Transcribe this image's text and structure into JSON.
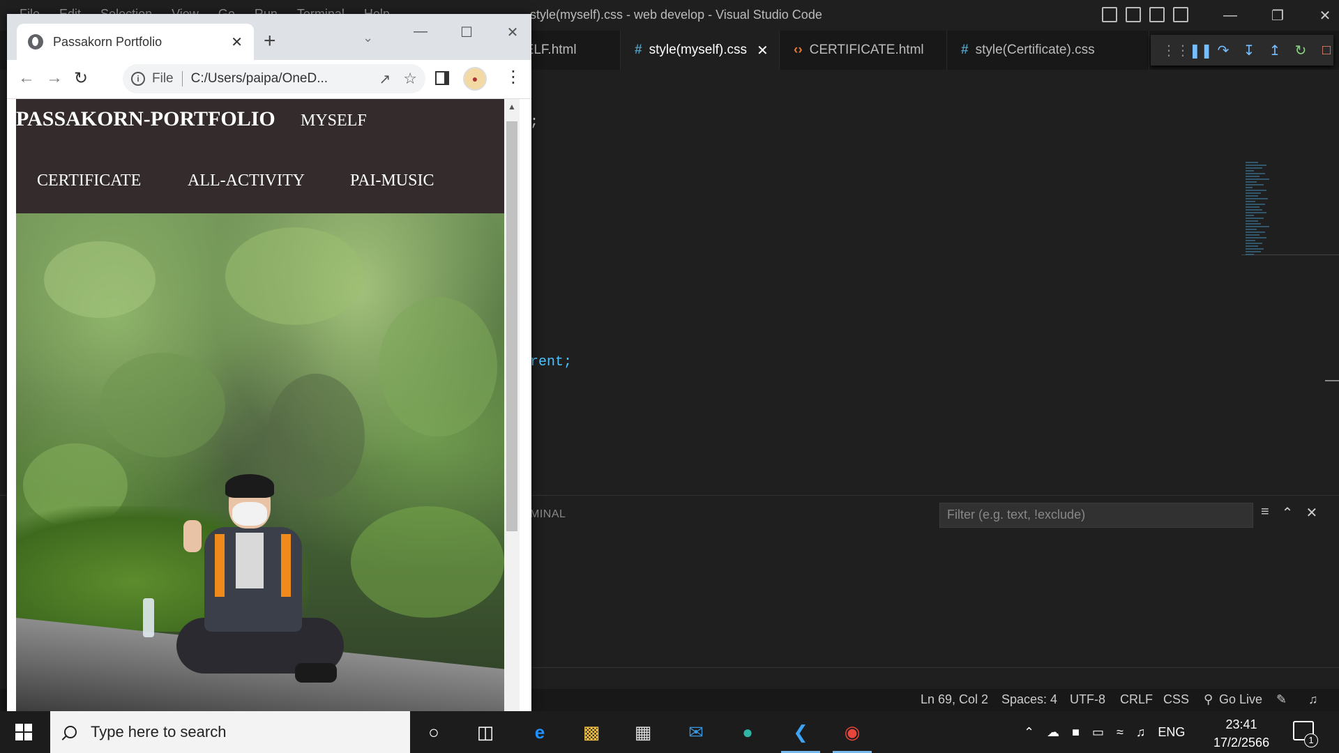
{
  "vscode": {
    "menu": [
      "File",
      "Edit",
      "Selection",
      "View",
      "Go",
      "Run",
      "Terminal",
      "Help"
    ],
    "title": "style(myself).css - web develop - Visual Studio Code",
    "tabs": [
      {
        "label": "MYSELF.html",
        "icon": "html",
        "visible_label": "SELF.html"
      },
      {
        "label": "style(myself).css",
        "icon": "css",
        "active": true
      },
      {
        "label": "CERTIFICATE.html",
        "icon": "html"
      },
      {
        "label": "style(Certificate).css",
        "icon": "css"
      }
    ],
    "debug_toolbar": [
      "grip-icon",
      "pause-icon",
      "step-over-icon",
      "step-into-icon",
      "step-out-icon",
      "restart-icon",
      "stop-icon"
    ],
    "code_fragments": [
      {
        "text": ";"
      },
      {
        "text": "rent;"
      }
    ],
    "panel": {
      "label": "MINAL",
      "filter_placeholder": "Filter (e.g. text, !exclude)"
    },
    "status": {
      "position": "Ln 69, Col 2",
      "spaces": "Spaces: 4",
      "encoding": "UTF-8",
      "eol": "CRLF",
      "language": "CSS",
      "golive": "Go Live"
    }
  },
  "chrome": {
    "tab_title": "Passakorn Portfolio",
    "omnibox": {
      "scheme_label": "File",
      "url": "C:/Users/paipa/OneD..."
    }
  },
  "site": {
    "brand": "PASSAKORN-PORTFOLIO",
    "nav": [
      "MYSELF",
      "CERTIFICATE",
      "ALL-ACTIVITY",
      "PAI-MUSIC"
    ]
  },
  "taskbar": {
    "search_placeholder": "Type here to search",
    "apps": [
      "cortana-icon",
      "task-view-icon",
      "edge-legacy-icon",
      "file-explorer-icon",
      "microsoft-store-icon",
      "mail-icon",
      "edge-icon",
      "vscode-icon",
      "chrome-icon"
    ],
    "tray_language": "ENG",
    "time": "23:41",
    "date": "17/2/2566",
    "notification_count": "1"
  },
  "colors": {
    "site_nav_bg": "#342c2c",
    "vscode_bg": "#1e1e1e",
    "css_icon": "#519aba",
    "html_icon": "#e37933",
    "taskbar_bg": "#1c1c1c"
  }
}
